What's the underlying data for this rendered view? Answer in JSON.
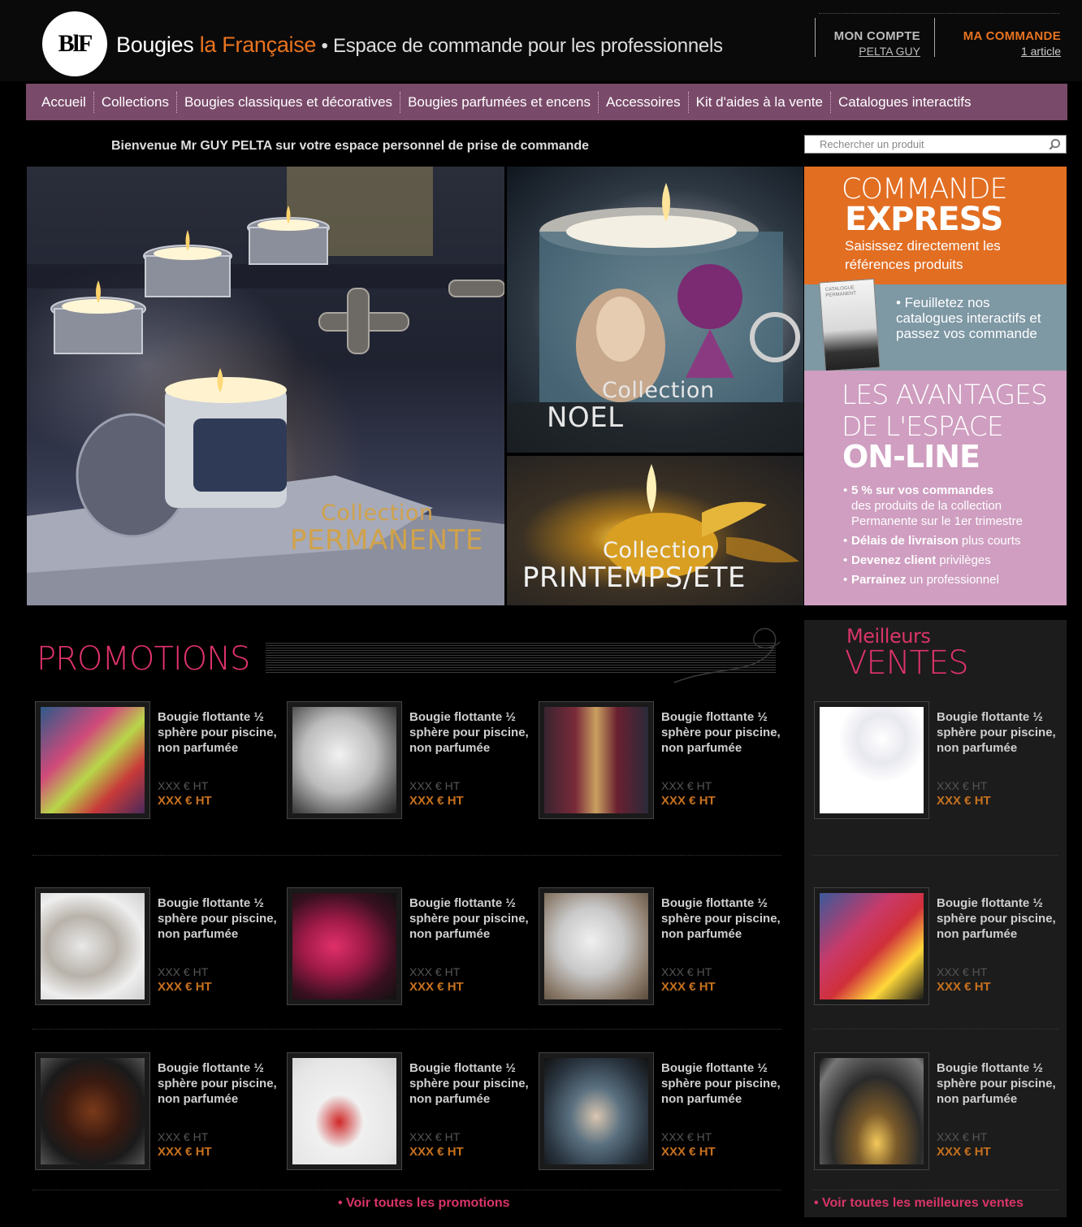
{
  "header": {
    "logo_text": "BlF",
    "brand_part1": "Bougies ",
    "brand_part2": "la Française",
    "brand_part3": " • Espace de commande pour les professionnels",
    "account_label": "MON COMPTE",
    "account_user": "PELTA GUY",
    "order_label": "MA COMMANDE",
    "order_count": "1 article"
  },
  "nav": {
    "items": [
      {
        "label": "Accueil"
      },
      {
        "label": "Collections"
      },
      {
        "label": "Bougies classiques et décoratives"
      },
      {
        "label": "Bougies parfumées et encens"
      },
      {
        "label": "Accessoires"
      },
      {
        "label": "Kit d'aides à la vente"
      },
      {
        "label": "Catalogues interactifs"
      }
    ]
  },
  "welcome": "Bienvenue Mr GUY PELTA sur votre espace personnel de prise de commande",
  "search": {
    "placeholder": "Rechercher un produit"
  },
  "hero": {
    "permanente": {
      "line1": "Collection",
      "line2": "PERMANENTE"
    },
    "noel": {
      "line1": "Collection",
      "line2": "NOEL"
    },
    "printemps": {
      "line1": "Collection",
      "line2": "PRINTEMPS/ETE"
    }
  },
  "express": {
    "title1": "COMMANDE",
    "title2": "EXPRESS",
    "desc": "Saisissez directement les références produits"
  },
  "catalog": {
    "book_text": "CATALOGUE PERMANENT",
    "desc": "• Feuilletez nos catalogues interactifs et passez vos commande"
  },
  "avantages": {
    "title1": "LES AVANTAGES",
    "title2": "DE L'ESPACE",
    "title3": "ON-LINE",
    "items": [
      {
        "bold": "5 % sur vos commandes",
        "rest": "des produits de la collection Permanente sur le 1er trimestre"
      },
      {
        "bold": "Délais de livraison",
        "rest": " plus courts"
      },
      {
        "bold": "Devenez client",
        "rest": " privilèges"
      },
      {
        "bold": "Parrainez",
        "rest": " un professionnel"
      }
    ]
  },
  "promotions": {
    "title": "PROMOTIONS",
    "link": "• Voir toutes les promotions",
    "products": [
      {
        "name": "Bougie flottante ½ sphère pour piscine, non parfumée",
        "old_price": "XXX € HT",
        "price": "XXX € HT"
      },
      {
        "name": "Bougie flottante ½ sphère pour piscine, non parfumée",
        "old_price": "XXX € HT",
        "price": "XXX € HT"
      },
      {
        "name": "Bougie flottante ½ sphère pour piscine, non parfumée",
        "old_price": "XXX € HT",
        "price": "XXX € HT"
      },
      {
        "name": "Bougie flottante ½ sphère pour piscine, non parfumée",
        "old_price": "XXX € HT",
        "price": "XXX € HT"
      },
      {
        "name": "Bougie flottante ½ sphère pour piscine, non parfumée",
        "old_price": "XXX € HT",
        "price": "XXX € HT"
      },
      {
        "name": "Bougie flottante ½ sphère pour piscine, non parfumée",
        "old_price": "XXX € HT",
        "price": "XXX € HT"
      },
      {
        "name": "Bougie flottante ½ sphère pour piscine, non parfumée",
        "old_price": "XXX € HT",
        "price": "XXX € HT"
      },
      {
        "name": "Bougie flottante ½ sphère pour piscine, non parfumée",
        "old_price": "XXX € HT",
        "price": "XXX € HT"
      },
      {
        "name": "Bougie flottante ½ sphère pour piscine, non parfumée",
        "old_price": "XXX € HT",
        "price": "XXX € HT"
      }
    ]
  },
  "best_sellers": {
    "title1": "Meilleurs",
    "title2": "VENTES",
    "link": "• Voir toutes les meilleures ventes",
    "products": [
      {
        "name": "Bougie flottante ½ sphère pour piscine, non parfumée",
        "old_price": "XXX € HT",
        "price": "XXX € HT"
      },
      {
        "name": "Bougie flottante ½ sphère pour piscine, non parfumée",
        "old_price": "XXX € HT",
        "price": "XXX € HT"
      },
      {
        "name": "Bougie flottante ½ sphère pour piscine, non parfumée",
        "old_price": "XXX € HT",
        "price": "XXX € HT"
      }
    ]
  },
  "colors": {
    "accent_orange": "#e26e22",
    "nav_purple": "#7a4a6a",
    "pink": "#e0336a",
    "catalog_blue": "#7e98a4",
    "avantages_pink": "#cf9ec0"
  }
}
